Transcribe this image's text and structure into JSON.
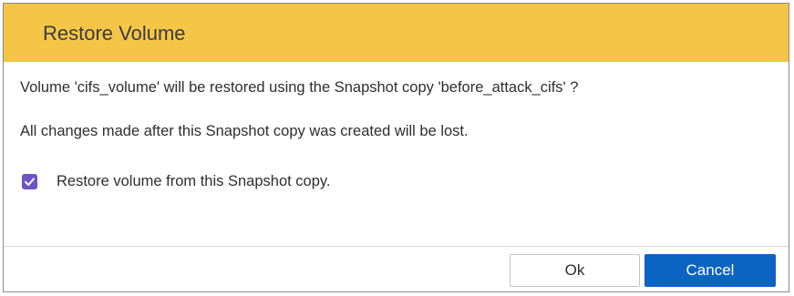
{
  "dialog": {
    "title": "Restore Volume",
    "message_1": "Volume 'cifs_volume' will be restored using the Snapshot copy 'before_attack_cifs' ?",
    "message_2": "All changes made after this Snapshot copy was created will be lost.",
    "option": {
      "label": "Restore volume from this Snapshot copy.",
      "checked": true
    },
    "buttons": {
      "ok_label": "Ok",
      "cancel_label": "Cancel"
    }
  },
  "colors": {
    "header_bg": "#f5c548",
    "checkbox": "#6b55c7",
    "primary_button": "#0b63c2"
  }
}
